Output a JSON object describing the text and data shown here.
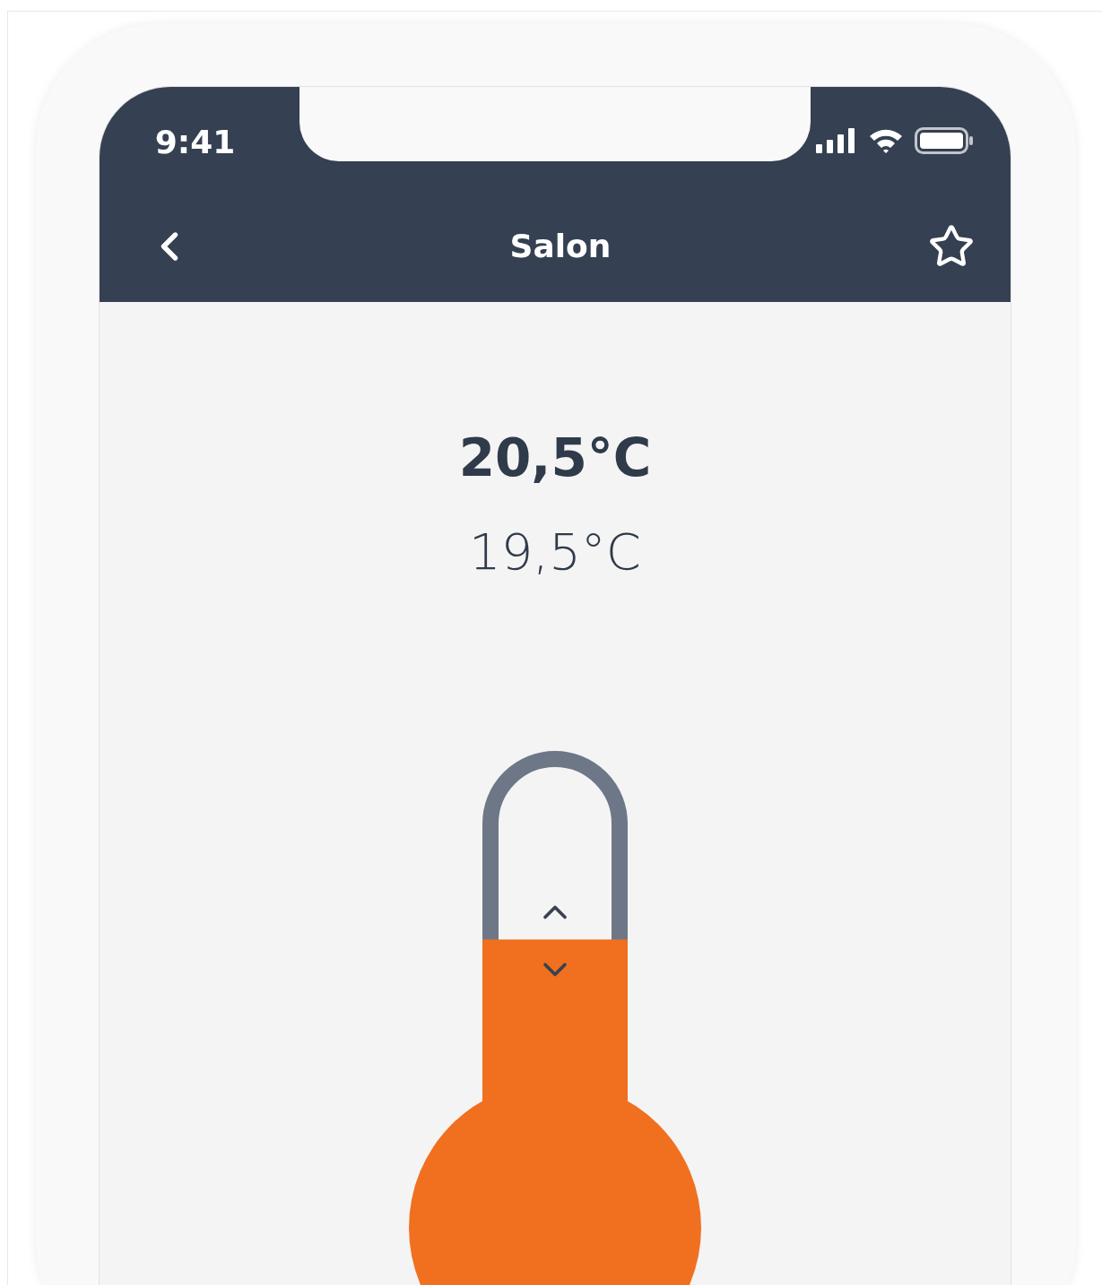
{
  "status_bar": {
    "time": "9:41"
  },
  "nav": {
    "title": "Salon",
    "favorite": false
  },
  "temperature": {
    "current": "20,5°C",
    "target": "19,5°C"
  },
  "thermostat": {
    "level": 0.47
  }
}
